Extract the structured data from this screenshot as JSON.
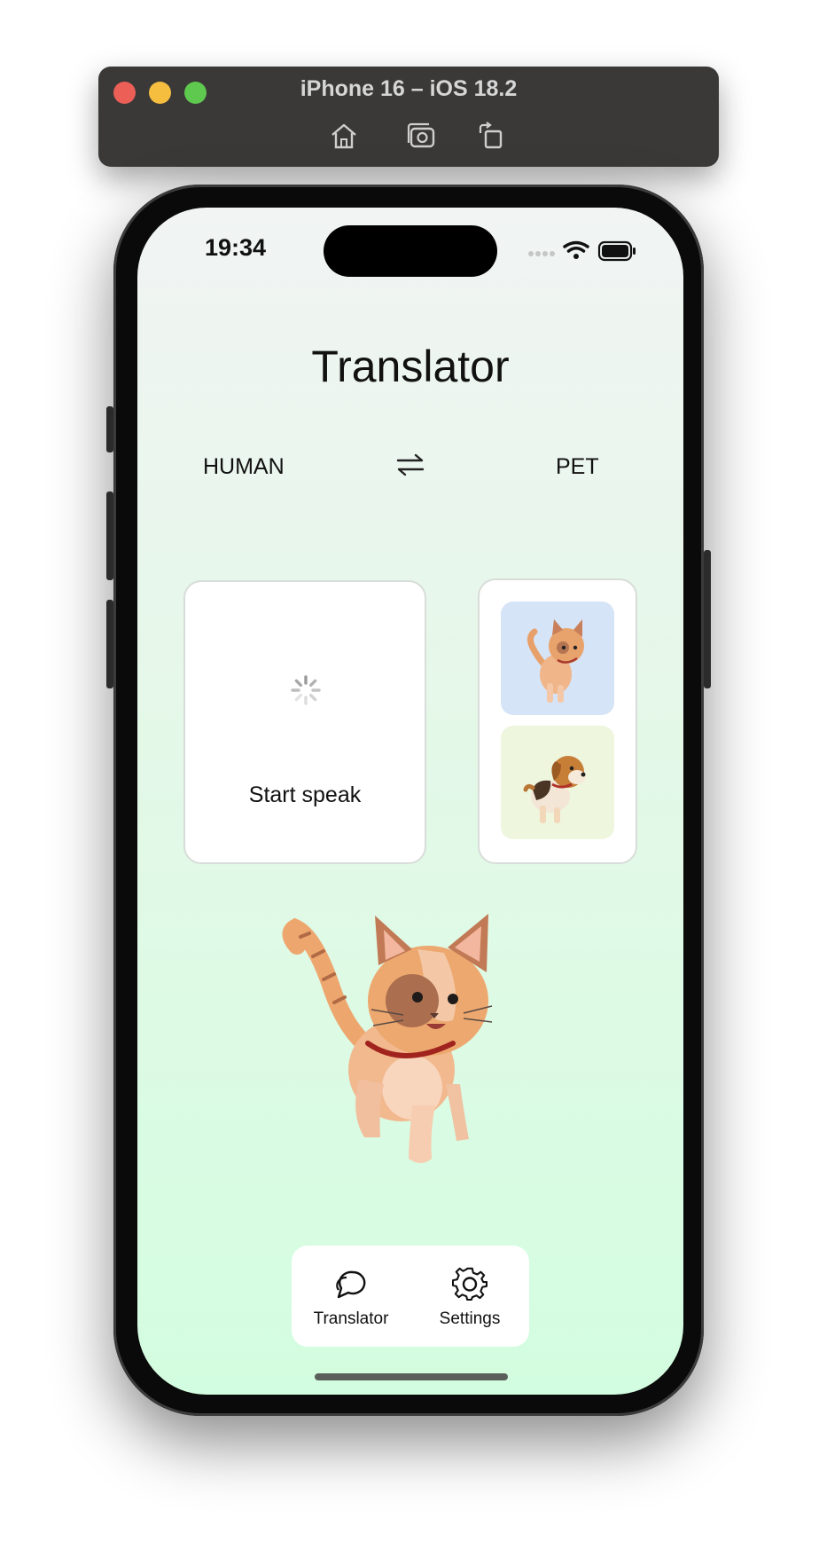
{
  "simulator": {
    "title": "iPhone 16 – iOS 18.2",
    "toolbar": [
      "home-icon",
      "screenshot-icon",
      "rotate-icon"
    ]
  },
  "status_bar": {
    "time": "19:34"
  },
  "screen": {
    "title": "Translator",
    "source_language": "HUMAN",
    "target_language": "PET",
    "speak_card": {
      "label": "Start speak"
    },
    "pet_selector": {
      "pets": [
        {
          "name": "cat",
          "bg": "#d6e4f7"
        },
        {
          "name": "dog",
          "bg": "#eef6dd"
        }
      ]
    }
  },
  "tab_bar": {
    "tabs": [
      {
        "label": "Translator",
        "icon": "chat-bubbles-icon"
      },
      {
        "label": "Settings",
        "icon": "gear-icon"
      }
    ]
  },
  "colors": {
    "background_top": "#f1f4f3",
    "background_bottom": "#d3fde0",
    "card": "#ffffff"
  }
}
